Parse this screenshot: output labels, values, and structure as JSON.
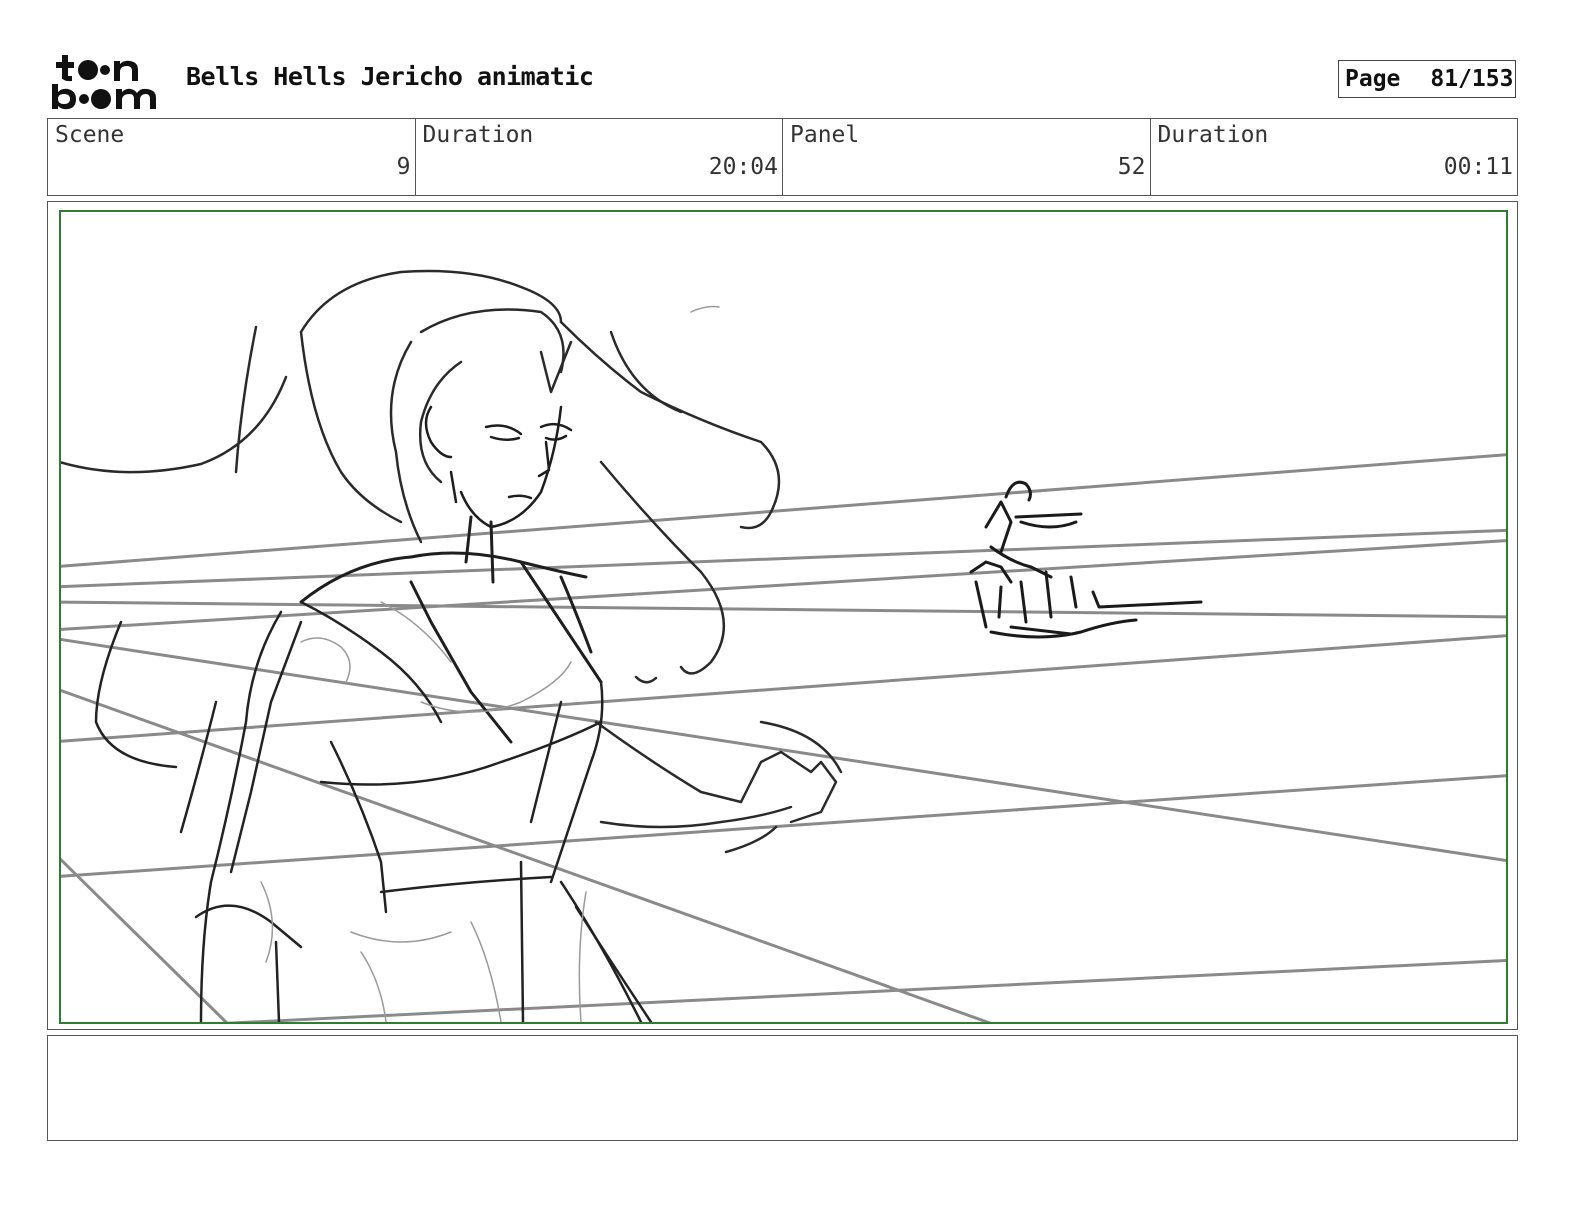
{
  "header": {
    "logo_text": "toon boom",
    "project_title": "Bells Hells Jericho animatic",
    "page_label": "Page",
    "page_number": "81/153"
  },
  "info": {
    "scene_label": "Scene",
    "scene_value": "9",
    "scene_duration_label": "Duration",
    "scene_duration_value": "20:04",
    "panel_label": "Panel",
    "panel_value": "52",
    "panel_duration_label": "Duration",
    "panel_duration_value": "00:11"
  },
  "panel": {
    "frame_color": "#2e7d32",
    "content": "storyboard-sketch"
  },
  "notes": {
    "text": ""
  }
}
